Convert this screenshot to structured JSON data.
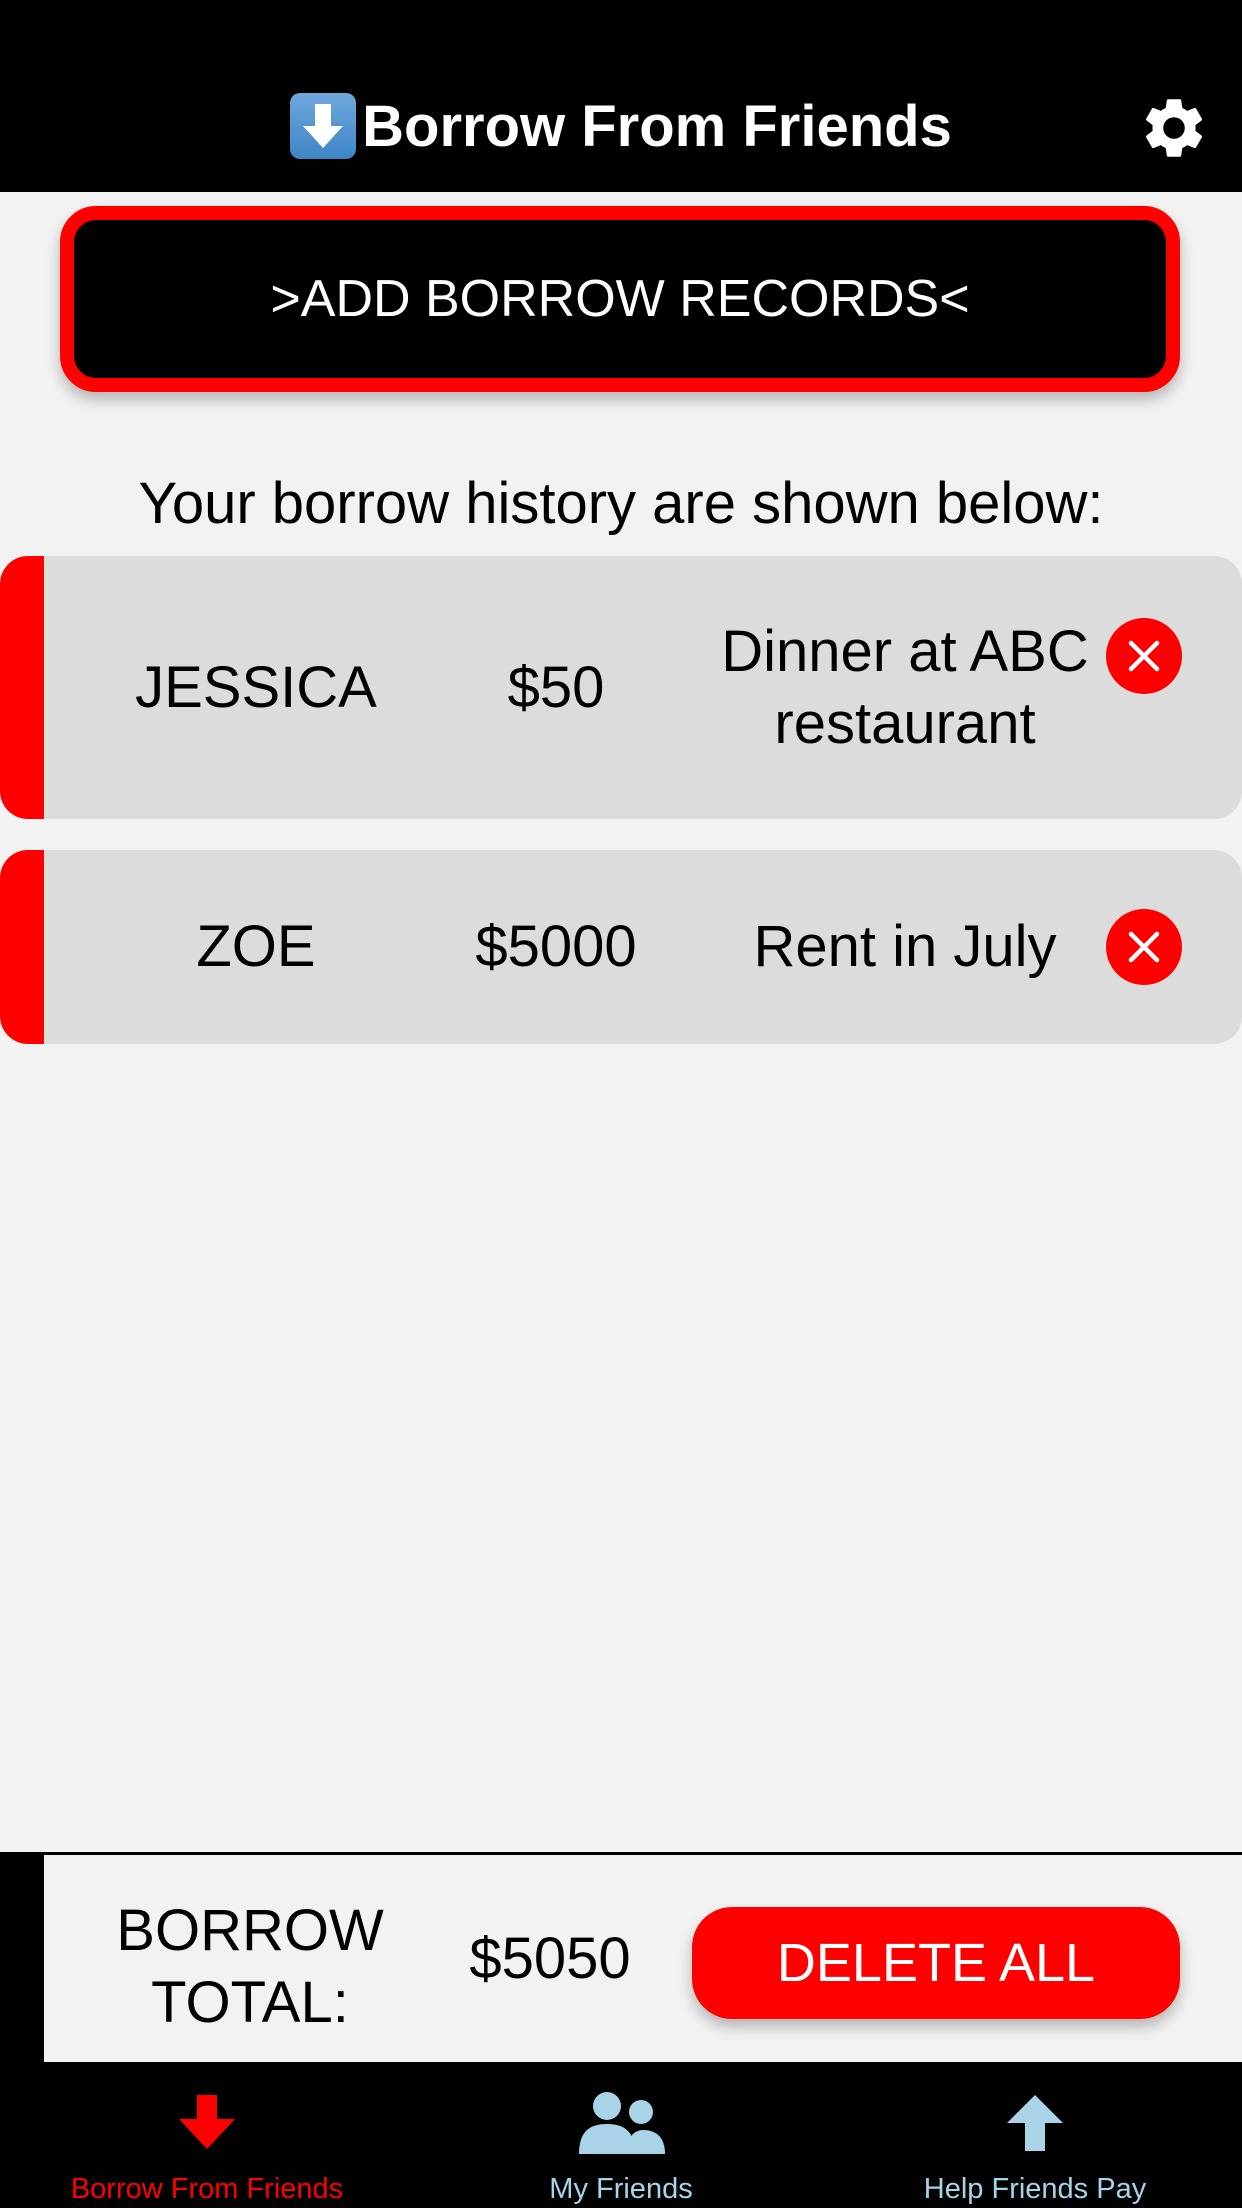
{
  "header": {
    "title": "Borrow From Friends",
    "emoji_icon": "down-arrow-emoji-icon",
    "settings_icon": "gear-icon"
  },
  "add_button": {
    "label": ">ADD BORROW RECORDS<"
  },
  "history_label": "Your borrow history are shown below:",
  "records": [
    {
      "name": "JESSICA",
      "amount": "$50",
      "description": "Dinner at ABC restaurant"
    },
    {
      "name": "ZOE",
      "amount": "$5000",
      "description": "Rent in July"
    }
  ],
  "footer": {
    "total_label": "BORROW TOTAL:",
    "total_value": "$5050",
    "delete_all_label": "DELETE ALL"
  },
  "tabs": [
    {
      "label": "Borrow From Friends",
      "icon": "down-arrow-icon",
      "active": true
    },
    {
      "label": "My Friends",
      "icon": "people-icon",
      "active": false
    },
    {
      "label": "Help Friends Pay",
      "icon": "up-arrow-icon",
      "active": false
    }
  ],
  "colors": {
    "accent": "#ff0000",
    "tab_active": "#ff0000",
    "tab_inactive": "#a9d3e6",
    "background": "#f2f2f2",
    "record_bg": "#dcdcdc"
  }
}
